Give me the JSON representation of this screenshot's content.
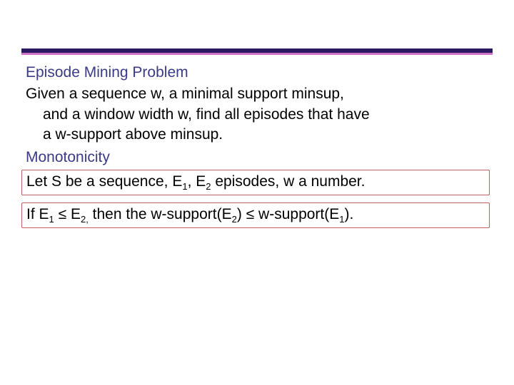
{
  "headings": {
    "problem": "Episode Mining Problem",
    "mono": "Monotonicity"
  },
  "problem": {
    "l1": "Given a sequence w, a minimal support minsup,",
    "l2": "and a window width w, find all episodes that have",
    "l3": "a w-support above minsup."
  },
  "mono": {
    "boxed_l1a": "Let S be a sequence, E",
    "boxed_l1_sub1": "1",
    "boxed_l1b": ", E",
    "boxed_l1_sub2": "2",
    "boxed_l1c": " episodes, w a number.",
    "boxed_l2a": "If E",
    "boxed_l2_sub1": "1",
    "boxed_l2b": " ≤ E",
    "boxed_l2_sub2": "2,",
    "boxed_l2c": " then the w-support(E",
    "boxed_l2_sub3": "2",
    "boxed_l2d": ") ≤ w-support(E",
    "boxed_l2_sub4": "1",
    "boxed_l2e": ")."
  }
}
